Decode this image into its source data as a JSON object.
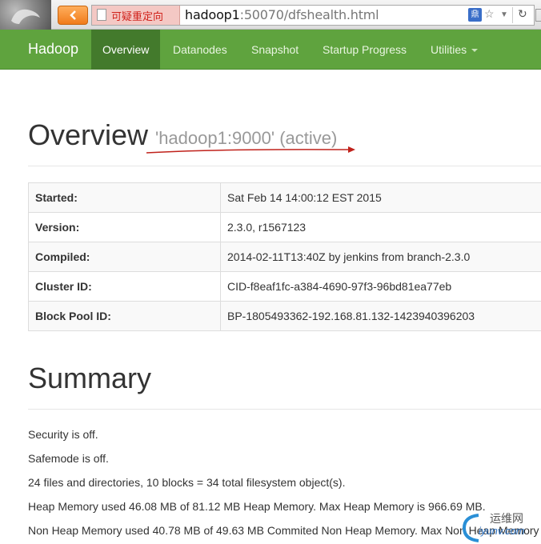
{
  "browser": {
    "back_icon": "chevron-left-icon",
    "redirect_label": "可疑重定向",
    "url_host": "hadoop1",
    "url_rest": ":50070/dfshealth.html",
    "addr_badge": "鼎",
    "icons": [
      "page-icon",
      "star-icon",
      "dropdown-icon",
      "reload-icon"
    ]
  },
  "navbar": {
    "brand": "Hadoop",
    "items": [
      {
        "label": "Overview",
        "active": true
      },
      {
        "label": "Datanodes",
        "active": false
      },
      {
        "label": "Snapshot",
        "active": false
      },
      {
        "label": "Startup Progress",
        "active": false
      },
      {
        "label": "Utilities",
        "active": false,
        "dropdown": true
      }
    ],
    "bg_color": "#5fa33e",
    "active_color": "#437a2c"
  },
  "overview": {
    "title": "Overview",
    "subtitle": "'hadoop1:9000' (active)",
    "rows": [
      {
        "key": "Started:",
        "value": "Sat Feb 14 14:00:12 EST 2015"
      },
      {
        "key": "Version:",
        "value": "2.3.0, r1567123"
      },
      {
        "key": "Compiled:",
        "value": "2014-02-11T13:40Z by jenkins from branch-2.3.0"
      },
      {
        "key": "Cluster ID:",
        "value": "CID-f8eaf1fc-a384-4690-97f3-96bd81ea77eb"
      },
      {
        "key": "Block Pool ID:",
        "value": "BP-1805493362-192.168.81.132-1423940396203"
      }
    ]
  },
  "summary": {
    "title": "Summary",
    "lines": [
      "Security is off.",
      "Safemode is off.",
      "24 files and directories, 10 blocks = 34 total filesystem object(s).",
      "Heap Memory used 46.08 MB of 81.12 MB Heap Memory. Max Heap Memory is 966.69 MB.",
      "Non Heap Memory used 40.78 MB of 49.63 MB Commited Non Heap Memory. Max Non Heap Memory"
    ]
  },
  "watermark": {
    "cn": "运维网",
    "en": "iyunv.com"
  }
}
